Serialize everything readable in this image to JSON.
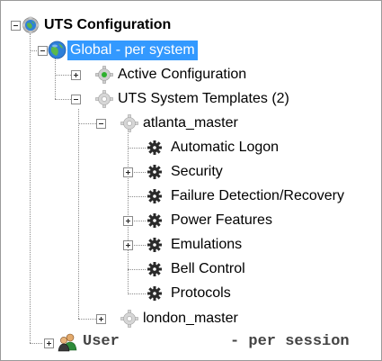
{
  "tree": {
    "root": {
      "label": "UTS Configuration",
      "icon": "globe-gear-icon",
      "state": "expanded"
    },
    "global": {
      "label": "Global - per system",
      "icon": "globe-icon",
      "state": "expanded",
      "selected": true,
      "selection_color": "#3399ff"
    },
    "active_configuration": {
      "label": "Active Configuration",
      "icon": "gear-green-dot-icon",
      "state": "collapsed"
    },
    "system_templates": {
      "label": "UTS System Templates (2)",
      "icon": "gear-icon",
      "state": "expanded"
    },
    "atlanta_master": {
      "label": "atlanta_master",
      "icon": "gear-icon",
      "state": "expanded"
    },
    "atlanta_children": [
      {
        "label": "Automatic Logon",
        "icon": "cog-icon",
        "state": "leaf"
      },
      {
        "label": "Security",
        "icon": "cog-icon",
        "state": "collapsed"
      },
      {
        "label": "Failure Detection/Recovery",
        "icon": "cog-icon",
        "state": "leaf"
      },
      {
        "label": "Power Features",
        "icon": "cog-icon",
        "state": "collapsed"
      },
      {
        "label": "Emulations",
        "icon": "cog-icon",
        "state": "collapsed"
      },
      {
        "label": "Bell Control",
        "icon": "cog-icon",
        "state": "leaf"
      },
      {
        "label": "Protocols",
        "icon": "cog-icon",
        "state": "leaf"
      }
    ],
    "london_master": {
      "label": "london_master",
      "icon": "gear-icon",
      "state": "collapsed"
    },
    "user": {
      "label": "User",
      "suffix": "- per session",
      "icon": "users-icon",
      "state": "collapsed"
    }
  }
}
